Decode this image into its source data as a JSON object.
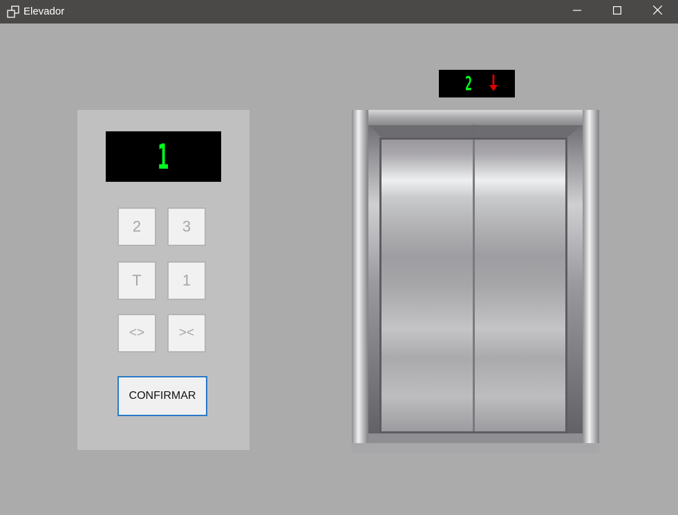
{
  "window": {
    "title": "Elevador",
    "app_icon": "windows-app-icon",
    "controls": [
      "minimize-icon",
      "maximize-icon",
      "close-icon"
    ]
  },
  "panel": {
    "display_floor": "1",
    "buttons": {
      "floor_2": "2",
      "floor_3": "3",
      "floor_t": "T",
      "floor_1": "1",
      "open_doors": "<>",
      "close_doors": "><"
    },
    "confirm_label": "CONFIRMAR"
  },
  "floor_indicator": {
    "floor": "2",
    "direction": "down",
    "direction_icon": "down-arrow-icon"
  },
  "colors": {
    "display_text": "#00ff1e",
    "arrow": "#e00000",
    "background": "#ababab",
    "panel": "#c0c0c0",
    "confirm_border": "#2a78c8"
  }
}
